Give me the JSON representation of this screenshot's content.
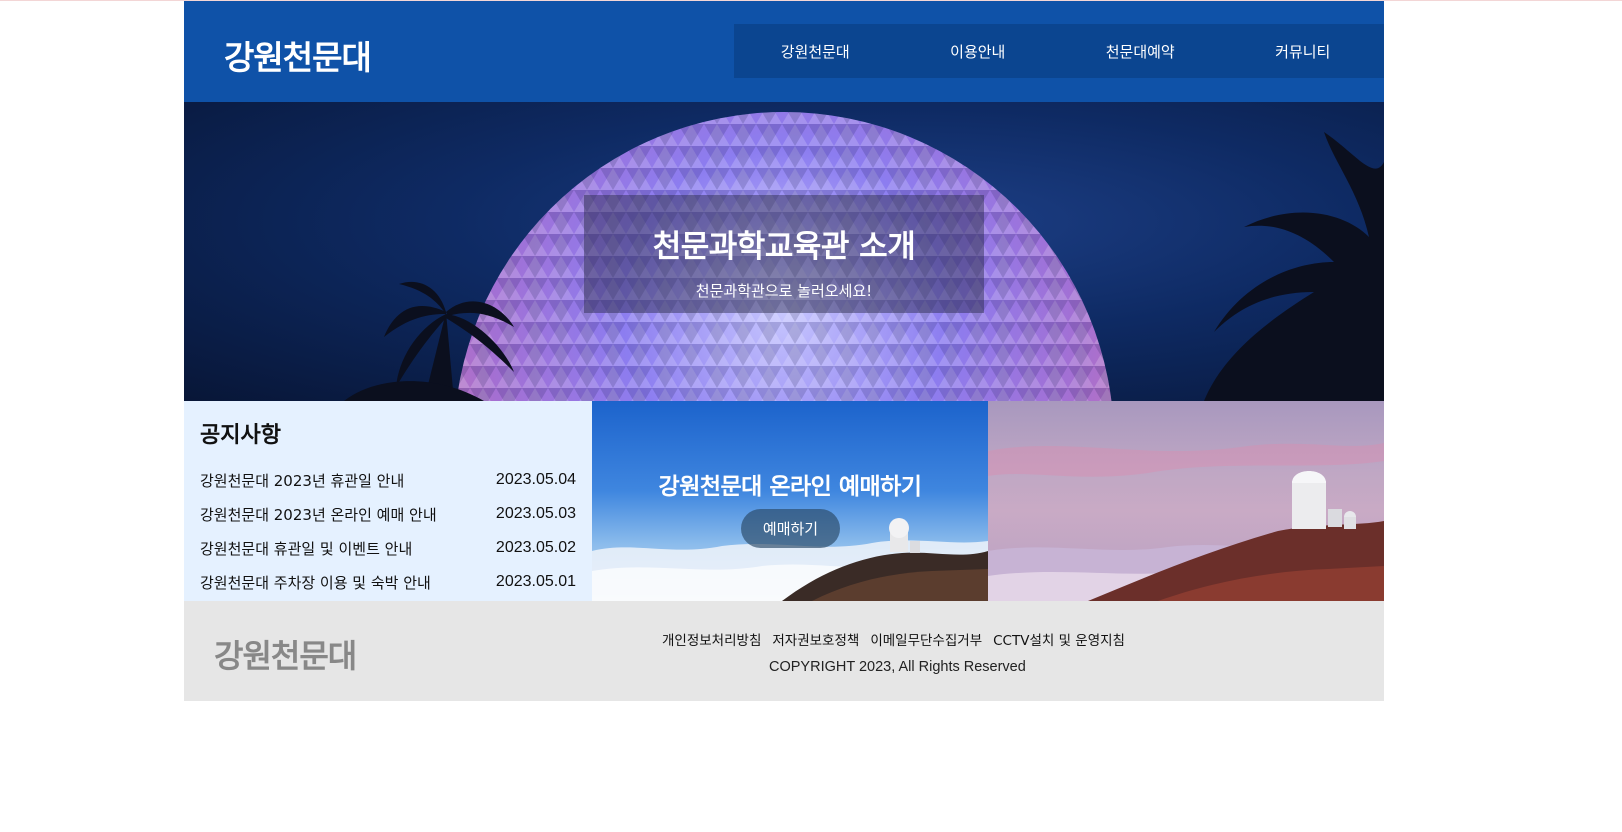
{
  "header": {
    "logo": "강원천문대",
    "nav": [
      "강원천문대",
      "이용안내",
      "천문대예약",
      "커뮤니티"
    ]
  },
  "hero": {
    "title": "천문과학교육관 소개",
    "subtitle": "천문과학관으로 놀러오세요!"
  },
  "notice": {
    "title": "공지사항",
    "items": [
      {
        "title": "강원천문대 2023년 휴관일 안내",
        "date": "2023.05.04"
      },
      {
        "title": "강원천문대 2023년 온라인 예매 안내",
        "date": "2023.05.03"
      },
      {
        "title": "강원천문대 휴관일 및 이벤트 안내",
        "date": "2023.05.02"
      },
      {
        "title": "강원천문대 주차장 이용 및 숙박 안내",
        "date": "2023.05.01"
      }
    ]
  },
  "booking": {
    "title": "강원천문대 온라인 예매하기",
    "button": "예매하기"
  },
  "footer": {
    "logo": "강원천문대",
    "links": [
      "개인정보처리방침",
      "저자권보호정책",
      "이메일무단수집거부",
      "CCTV설치 및 운영지침"
    ],
    "copyright": "COPYRIGHT 2023, All Rights Reserved"
  },
  "colors": {
    "header_bg": "#0f52a8",
    "nav_bg": "#0b4590",
    "notice_bg": "#e5f1ff",
    "footer_bg": "#e6e6e6"
  }
}
